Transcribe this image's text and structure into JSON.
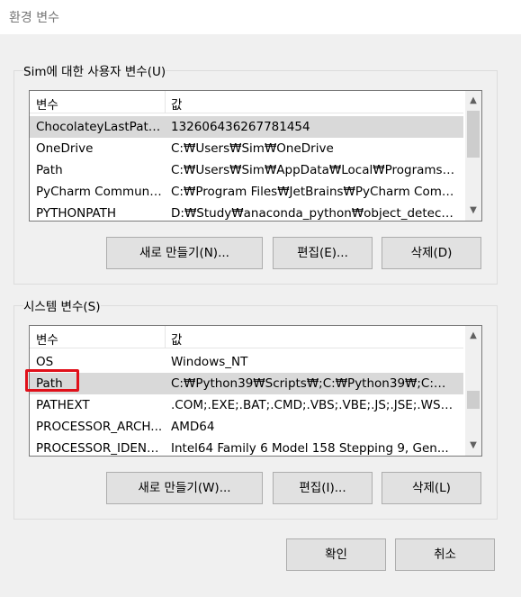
{
  "window": {
    "title": "환경 변수"
  },
  "user_section": {
    "label": "Sim에 대한 사용자 변수(U)",
    "columns": [
      "변수",
      "값"
    ],
    "rows": [
      {
        "name": "ChocolateyLastPath...",
        "value": "132606436267781454"
      },
      {
        "name": "OneDrive",
        "value": "C:₩Users₩Sim₩OneDrive"
      },
      {
        "name": "Path",
        "value": "C:₩Users₩Sim₩AppData₩Local₩Programs₩P..."
      },
      {
        "name": "PyCharm Communi...",
        "value": "C:₩Program Files₩JetBrains₩PyCharm Comm..."
      },
      {
        "name": "PYTHONPATH",
        "value": "D:₩Study₩anaconda_python₩object_detecti..."
      }
    ],
    "buttons": {
      "new": "새로 만들기(N)...",
      "edit": "편집(E)...",
      "delete": "삭제(D)"
    }
  },
  "system_section": {
    "label": "시스템 변수(S)",
    "columns": [
      "변수",
      "값"
    ],
    "rows": [
      {
        "name": "OS",
        "value": "Windows_NT"
      },
      {
        "name": "Path",
        "value": "C:₩Python39₩Scripts₩;C:₩Python39₩;C:₩Pro..."
      },
      {
        "name": "PATHEXT",
        "value": ".COM;.EXE;.BAT;.CMD;.VBS;.VBE;.JS;.JSE;.WSF;..."
      },
      {
        "name": "PROCESSOR_ARCH...",
        "value": "AMD64"
      },
      {
        "name": "PROCESSOR_IDENT...",
        "value": "Intel64 Family 6 Model 158 Stepping 9, Gen..."
      }
    ],
    "buttons": {
      "new": "새로 만들기(W)...",
      "edit": "편집(I)...",
      "delete": "삭제(L)"
    }
  },
  "footer": {
    "ok": "확인",
    "cancel": "취소"
  },
  "icons": {
    "scroll_up": "chevron-up-icon",
    "scroll_down": "chevron-down-icon"
  },
  "colors": {
    "highlight": "#e0101a",
    "selected_row": "#d9d9d9"
  }
}
